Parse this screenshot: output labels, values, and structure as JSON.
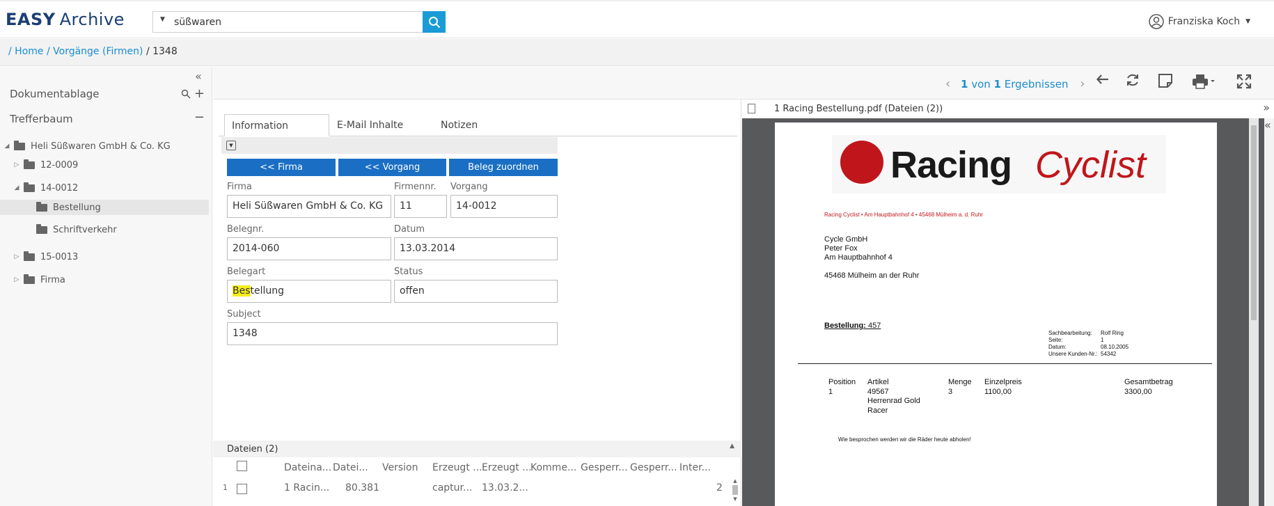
{
  "header": {
    "logo_bold": "EASY",
    "logo_light": "Archive",
    "search_value": "süßwaren",
    "user_name": "Franziska Koch"
  },
  "breadcrumb": {
    "home": "/ Home",
    "sep1": "/",
    "section": "Vorgänge (Firmen)",
    "current": "/ 1348"
  },
  "sidebar": {
    "section1": "Dokumentablage",
    "section2": "Trefferbaum",
    "tree": [
      {
        "label": "Heli Süßwaren GmbH & Co. KG",
        "state": "expanded"
      },
      {
        "label": "12-0009",
        "state": "collapsed"
      },
      {
        "label": "14-0012",
        "state": "expanded"
      },
      {
        "label": "Bestellung",
        "state": "selected"
      },
      {
        "label": "Schriftverkehr",
        "state": "leaf"
      },
      {
        "label": "15-0013",
        "state": "collapsed"
      },
      {
        "label": "Firma",
        "state": "collapsed"
      }
    ]
  },
  "toolbar": {
    "pager_num": "1",
    "pager_von": "von",
    "pager_total": "1",
    "pager_label": "Ergebnissen"
  },
  "tabs": [
    "Information",
    "E-Mail Inhalte",
    "Notizen"
  ],
  "buttons": {
    "firma": "<< Firma",
    "vorgang": "<< Vorgang",
    "zuordnen": "Beleg zuordnen"
  },
  "form": {
    "firma_label": "Firma",
    "firma_value": "Heli Süßwaren GmbH & Co. KG",
    "firmennr_label": "Firmennr.",
    "firmennr_value": "11",
    "vorgang_label": "Vorgang",
    "vorgang_value": "14-0012",
    "belegnr_label": "Belegnr.",
    "belegnr_value": "2014-060",
    "datum_label": "Datum",
    "datum_value": "13.03.2014",
    "belegart_label": "Belegart",
    "belegart_highlight": "Bes",
    "belegart_rest": "tellung",
    "status_label": "Status",
    "status_value": "offen",
    "subject_label": "Subject",
    "subject_value": "1348"
  },
  "files": {
    "title": "Dateien (2)",
    "columns": [
      "Dateina...",
      "Datei...",
      "Version",
      "Erzeugt ...",
      "Erzeugt ...",
      "Komme...",
      "Gesperr...",
      "Gesperr...",
      "Inter..."
    ],
    "row": {
      "index": "1",
      "name": "1 Racin...",
      "size": "80.381",
      "version": "",
      "created_by": "captur...",
      "created_at": "13.03.2...",
      "count": "2"
    }
  },
  "viewer": {
    "title": "1 Racing Bestellung.pdf (Dateien (2))",
    "doc": {
      "logo1": "Racing",
      "logo2": "Cyclist",
      "sender_line": "Racing Cyclist • Am Hauptbahnhof 4 • 45468 Mülheim a. d. Ruhr",
      "addr1": "Cycle GmbH",
      "addr2": "Peter Fox",
      "addr3": "Am Hauptbahnhof 4",
      "addr4": "45468 Mülheim an der Ruhr",
      "order_label": "Bestellung:",
      "order_no": "457",
      "meta_k1": "Sachbearbeitung:",
      "meta_v1": "Rolf Ring",
      "meta_k2": "Seite:",
      "meta_v2": "1",
      "meta_k3": "Datum:",
      "meta_v3": "08.10.2005",
      "meta_k4": "Unsere Kunden-Nr.:",
      "meta_v4": "54342",
      "col_pos": "Position",
      "col_art": "Artikel",
      "col_menge": "Menge",
      "col_ep": "Einzelpreis",
      "col_gb": "Gesamtbetrag",
      "r_pos": "1",
      "r_art1": "49567",
      "r_art2": "Herrenrad Gold",
      "r_art3": "Racer",
      "r_menge": "3",
      "r_ep": "1100,00",
      "r_gb": "3300,00",
      "note": "Wie besprochen werden wir die Räder heute abholen!"
    }
  }
}
